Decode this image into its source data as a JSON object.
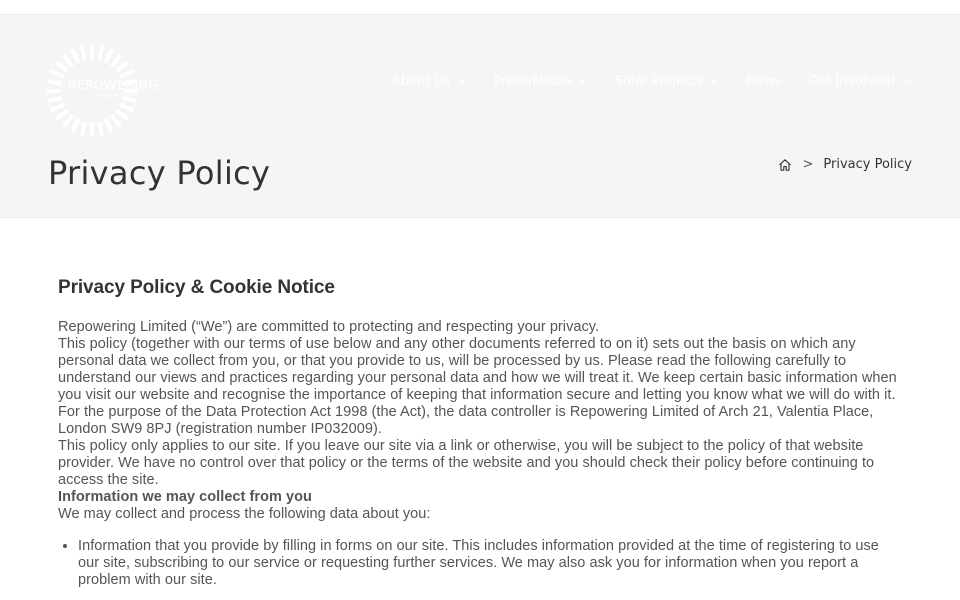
{
  "logo": {
    "name": "REPOWERING",
    "sub": "LONDON"
  },
  "nav": {
    "items": [
      {
        "label": "About Us",
        "has_dropdown": true
      },
      {
        "label": "Press/Media",
        "has_dropdown": true
      },
      {
        "label": "Solar Projects",
        "has_dropdown": true
      },
      {
        "label": "News",
        "has_dropdown": false
      },
      {
        "label": "Get Involved!",
        "has_dropdown": true
      }
    ]
  },
  "page_title": "Privacy Policy",
  "breadcrumb": {
    "home_icon": "home-icon",
    "separator": ">",
    "current": "Privacy Policy"
  },
  "content": {
    "heading": "Privacy Policy & Cookie Notice",
    "paragraphs": [
      "Repowering Limited (“We”) are committed to protecting and respecting your privacy.",
      "This policy (together with our terms of use below and any other documents referred to on it) sets out the basis on which any personal data we collect from you, or that you provide to us, will be processed by us. Please read the following carefully to understand our views and practices regarding your personal data and how we will treat it. We keep certain basic information when you visit our website and recognise the importance of keeping that information secure and letting you know what we will do with it.",
      "For the purpose of the Data Protection Act 1998 (the Act), the data controller is Repowering Limited of Arch 21, Valentia Place, London SW9 8PJ (registration number IP032009).",
      "This policy only applies to our site. If you leave our site via a link or otherwise, you will be subject to the policy of that website provider. We have no control over that policy or the terms of the website and you should check their policy before continuing to access the site."
    ],
    "subheading": "Information we may collect from you",
    "intro": "We may collect and process the following data about you:",
    "list": [
      "Information that you provide by filling in forms on our site. This includes information provided at the time of registering to use our site, subscribing to our service or requesting further services. We may also ask you for information when you report a problem with our site."
    ]
  },
  "colors": {
    "hero_bg": "#f5f5f5",
    "title": "#333333",
    "body_text": "#555555",
    "nav_text": "#ffffff"
  }
}
